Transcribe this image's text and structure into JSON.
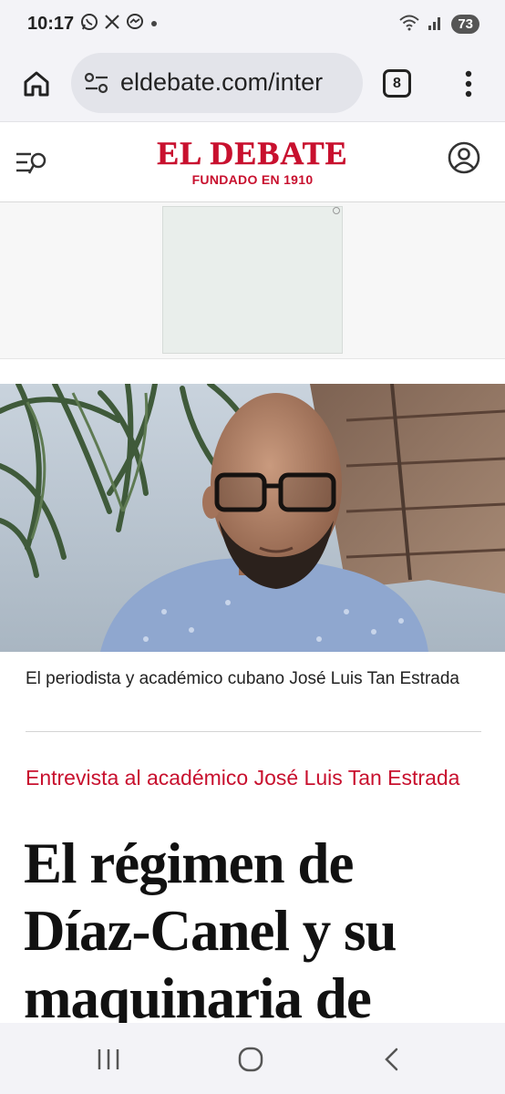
{
  "status_bar": {
    "time": "10:17",
    "battery": "73",
    "notification_icons": [
      "whatsapp-icon",
      "x-icon",
      "messenger-icon",
      "dot-icon"
    ],
    "system_icons": [
      "wifi-icon",
      "signal-icon",
      "battery-icon"
    ]
  },
  "browser": {
    "url": "eldebate.com/inter",
    "tab_count": "8",
    "icons": [
      "home-icon",
      "site-settings-icon",
      "tabs-icon",
      "more-vert-icon"
    ]
  },
  "site": {
    "logo": "EL DEBATE",
    "tagline": "FUNDADO EN 1910",
    "brand_color": "#c8102e",
    "icons": [
      "menu-search-icon",
      "account-icon"
    ]
  },
  "article": {
    "caption": "El periodista y académico cubano José Luis Tan Estrada",
    "kicker": "Entrevista al académico José Luis Tan Estrada",
    "headline": "El régimen de Díaz-Canel y su maquinaria de"
  },
  "nav": {
    "icons": [
      "recents-icon",
      "home-circle-icon",
      "back-icon"
    ]
  }
}
